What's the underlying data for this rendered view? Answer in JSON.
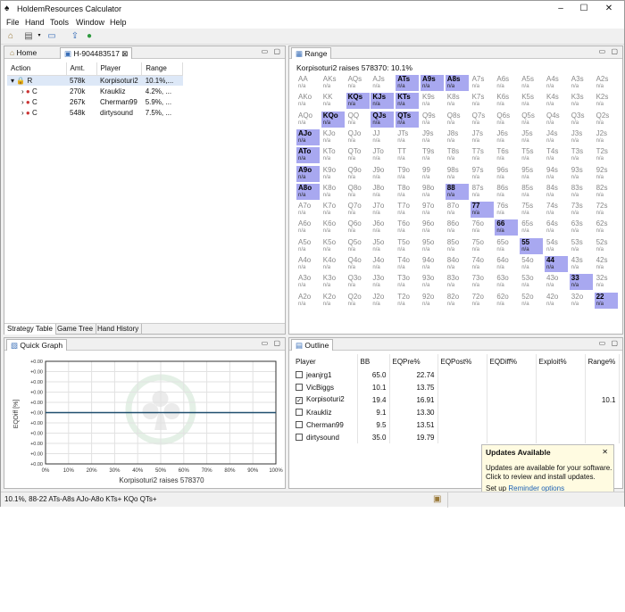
{
  "window": {
    "title": "HoldemResources Calculator",
    "minimize": "–",
    "maximize": "☐",
    "close": "✕"
  },
  "menu": [
    "File",
    "Hand",
    "Tools",
    "Window",
    "Help"
  ],
  "left_pane": {
    "tabs": [
      {
        "label": "Home"
      },
      {
        "label": "H-904483517"
      }
    ],
    "columns": [
      "Action",
      "Amt.",
      "Player",
      "Range"
    ],
    "rows": [
      {
        "expander": "▾",
        "action": "R",
        "amt": "578k",
        "player": "Korpisoturi2",
        "range": "10.1%,..."
      },
      {
        "expander": "›",
        "action": "C",
        "amt": "270k",
        "player": "Kraukliz",
        "range": "4.2%, ..."
      },
      {
        "expander": "›",
        "action": "C",
        "amt": "267k",
        "player": "Cherman99",
        "range": "5.9%, ..."
      },
      {
        "expander": "›",
        "action": "C",
        "amt": "548k",
        "player": "dirtysound",
        "range": "7.5%, ..."
      }
    ],
    "bottom_tabs": [
      "Strategy Table",
      "Game Tree",
      "Hand History"
    ]
  },
  "range_pane": {
    "tab": "Range",
    "header": "Korpisoturi2 raises 578370: 10.1%",
    "cell_sub": "n/a",
    "grid": [
      [
        "AA",
        "AKs",
        "AQs",
        "AJs",
        "ATs",
        "A9s",
        "A8s",
        "A7s",
        "A6s",
        "A5s",
        "A4s",
        "A3s",
        "A2s"
      ],
      [
        "AKo",
        "KK",
        "KQs",
        "KJs",
        "KTs",
        "K9s",
        "K8s",
        "K7s",
        "K6s",
        "K5s",
        "K4s",
        "K3s",
        "K2s"
      ],
      [
        "AQo",
        "KQo",
        "QQ",
        "QJs",
        "QTs",
        "Q9s",
        "Q8s",
        "Q7s",
        "Q6s",
        "Q5s",
        "Q4s",
        "Q3s",
        "Q2s"
      ],
      [
        "AJo",
        "KJo",
        "QJo",
        "JJ",
        "JTs",
        "J9s",
        "J8s",
        "J7s",
        "J6s",
        "J5s",
        "J4s",
        "J3s",
        "J2s"
      ],
      [
        "ATo",
        "KTo",
        "QTo",
        "JTo",
        "TT",
        "T9s",
        "T8s",
        "T7s",
        "T6s",
        "T5s",
        "T4s",
        "T3s",
        "T2s"
      ],
      [
        "A9o",
        "K9o",
        "Q9o",
        "J9o",
        "T9o",
        "99",
        "98s",
        "97s",
        "96s",
        "95s",
        "94s",
        "93s",
        "92s"
      ],
      [
        "A8o",
        "K8o",
        "Q8o",
        "J8o",
        "T8o",
        "98o",
        "88",
        "87s",
        "86s",
        "85s",
        "84s",
        "83s",
        "82s"
      ],
      [
        "A7o",
        "K7o",
        "Q7o",
        "J7o",
        "T7o",
        "97o",
        "87o",
        "77",
        "76s",
        "75s",
        "74s",
        "73s",
        "72s"
      ],
      [
        "A6o",
        "K6o",
        "Q6o",
        "J6o",
        "T6o",
        "96o",
        "86o",
        "76o",
        "66",
        "65s",
        "64s",
        "63s",
        "62s"
      ],
      [
        "A5o",
        "K5o",
        "Q5o",
        "J5o",
        "T5o",
        "95o",
        "85o",
        "75o",
        "65o",
        "55",
        "54s",
        "53s",
        "52s"
      ],
      [
        "A4o",
        "K4o",
        "Q4o",
        "J4o",
        "T4o",
        "94o",
        "84o",
        "74o",
        "64o",
        "54o",
        "44",
        "43s",
        "42s"
      ],
      [
        "A3o",
        "K3o",
        "Q3o",
        "J3o",
        "T3o",
        "93o",
        "83o",
        "73o",
        "63o",
        "53o",
        "43o",
        "33",
        "32s"
      ],
      [
        "A2o",
        "K2o",
        "Q2o",
        "J2o",
        "T2o",
        "92o",
        "82o",
        "72o",
        "62o",
        "52o",
        "42o",
        "32o",
        "22"
      ]
    ],
    "in_range": [
      "ATs",
      "A9s",
      "A8s",
      "KQs",
      "KJs",
      "KTs",
      "KQo",
      "QJs",
      "QTs",
      "AJo",
      "ATo",
      "A9o",
      "A8o",
      "88",
      "77",
      "66",
      "55",
      "44",
      "33",
      "22"
    ],
    "highlight_color": "#a8a8f0"
  },
  "graph_pane": {
    "tab": "Quick Graph",
    "ylabel": "EQDiff [%]",
    "xlabel": "Korpisoturi2 raises 578370",
    "yticks": [
      "+0.00",
      "+0.00",
      "+0.00",
      "+0.00",
      "+0.00",
      "+0.00",
      "+0.00",
      "+0.00",
      "+0.00",
      "+0.00",
      "+0.00"
    ],
    "xticks": [
      "0%",
      "10%",
      "20%",
      "30%",
      "40%",
      "50%",
      "60%",
      "70%",
      "80%",
      "90%",
      "100%"
    ]
  },
  "chart_data": {
    "type": "line",
    "xlabel": "Korpisoturi2 raises 578370",
    "ylabel": "EQDiff [%]",
    "series": [
      {
        "x": [
          0,
          100
        ],
        "y": [
          0,
          0
        ]
      }
    ],
    "xlim": [
      0,
      100
    ],
    "grid": true
  },
  "outline_pane": {
    "tab": "Outline",
    "columns": [
      "Player",
      "BB",
      "EQPre%",
      "EQPost%",
      "EQDiff%",
      "Exploit%",
      "Range%"
    ],
    "rows": [
      {
        "checked": false,
        "player": "jeanjrg1",
        "bb": "65.0",
        "eqpre": "22.74",
        "range": ""
      },
      {
        "checked": false,
        "player": "VicBiggs",
        "bb": "10.1",
        "eqpre": "13.75",
        "range": ""
      },
      {
        "checked": true,
        "player": "Korpisoturi2",
        "bb": "19.4",
        "eqpre": "16.91",
        "range": "10.1"
      },
      {
        "checked": false,
        "player": "Kraukliz",
        "bb": "9.1",
        "eqpre": "13.30",
        "range": ""
      },
      {
        "checked": false,
        "player": "Cherman99",
        "bb": "9.5",
        "eqpre": "13.51",
        "range": ""
      },
      {
        "checked": false,
        "player": "dirtysound",
        "bb": "35.0",
        "eqpre": "19.79",
        "range": ""
      }
    ]
  },
  "popup": {
    "title": "Updates Available",
    "body1": "Updates are available for your software.",
    "body2": "Click to review and install updates.",
    "setup_prefix": "Set up",
    "link": "Reminder options",
    "close": "✕"
  },
  "status": {
    "text": "10.1%, 88-22 ATs-A8s AJo-A8o KTs+ KQo QTs+"
  }
}
